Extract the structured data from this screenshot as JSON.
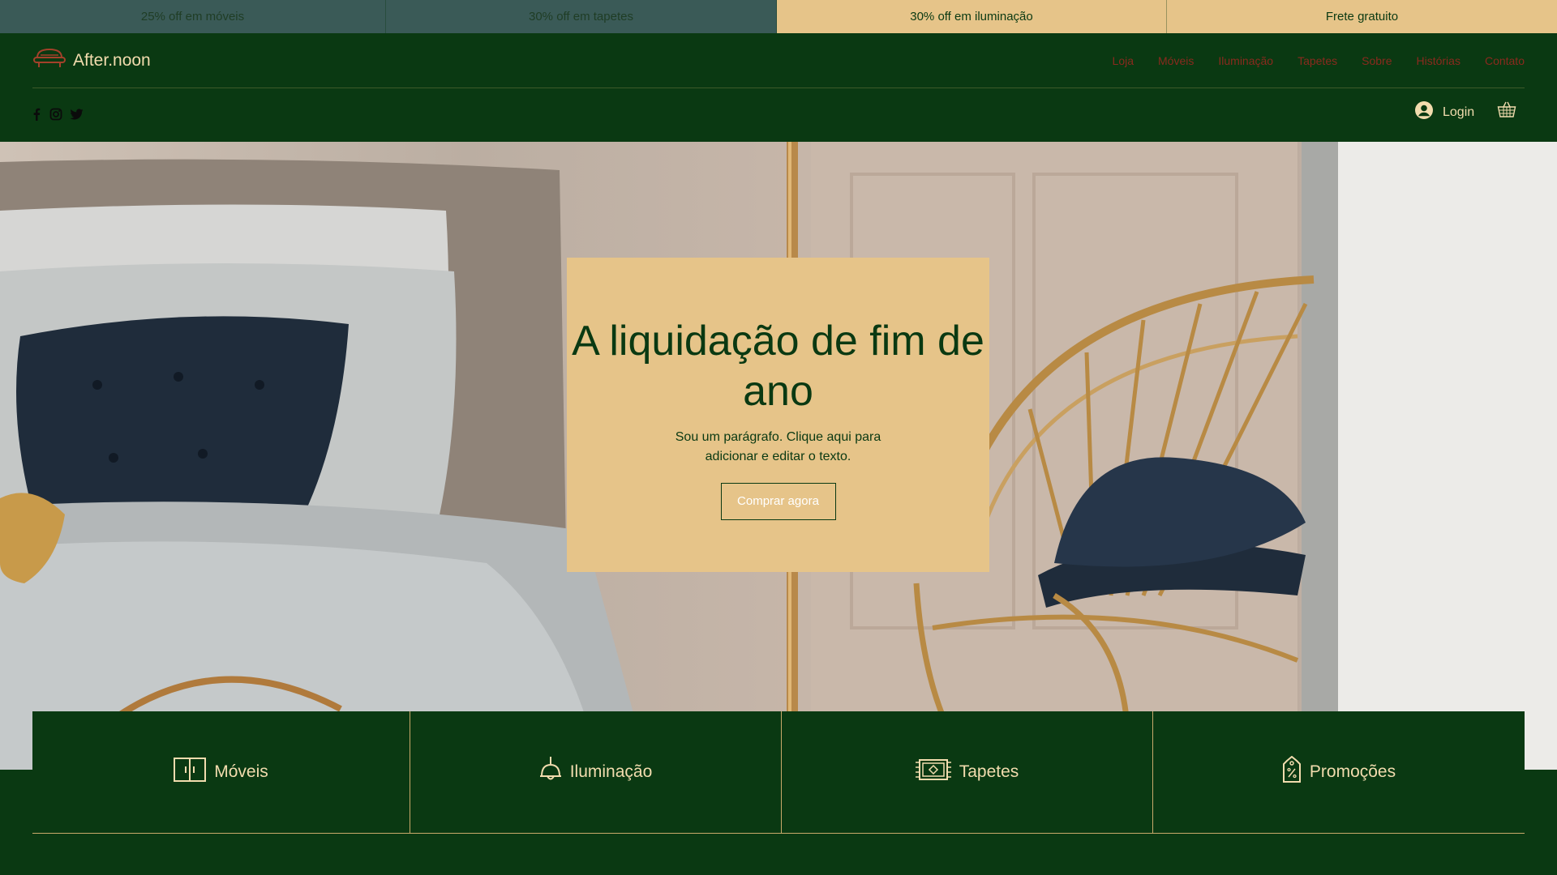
{
  "promo_bar": [
    {
      "text": "25% off em móveis"
    },
    {
      "text": "30% off em tapetes"
    },
    {
      "text": "30% off em iluminação"
    },
    {
      "text": "Frete gratuito"
    }
  ],
  "header": {
    "brand": "After.noon",
    "nav": [
      "Loja",
      "Móveis",
      "Iluminação",
      "Tapetes",
      "Sobre",
      "Histórias",
      "Contato"
    ],
    "social_icons": [
      "facebook-icon",
      "instagram-icon",
      "twitter-icon"
    ],
    "login_label": "Login",
    "cart_icon": "basket-icon"
  },
  "hero": {
    "title": "A liquidação de fim de ano",
    "paragraph": "Sou um parágrafo. Clique aqui para adicionar e editar o texto.",
    "cta_label": "Comprar agora"
  },
  "categories": [
    {
      "label": "Móveis",
      "icon": "cabinet-icon"
    },
    {
      "label": "Iluminação",
      "icon": "lamp-icon"
    },
    {
      "label": "Tapetes",
      "icon": "rug-icon"
    },
    {
      "label": "Promoções",
      "icon": "price-tag-icon"
    }
  ],
  "colors": {
    "dark_green": "#0a3912",
    "gold": "#e6c489",
    "cream": "#f2dcae",
    "nav_red": "#8a2a1e"
  }
}
